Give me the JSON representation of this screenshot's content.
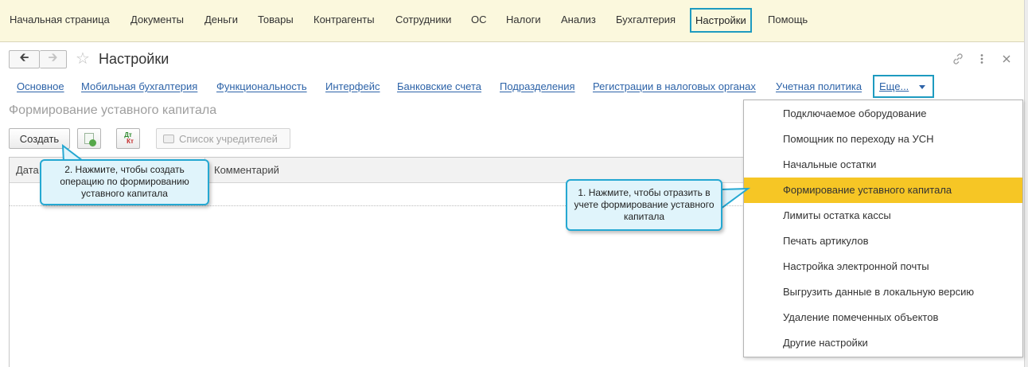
{
  "top_nav": {
    "items": [
      {
        "label": "Начальная страница"
      },
      {
        "label": "Документы"
      },
      {
        "label": "Деньги"
      },
      {
        "label": "Товары"
      },
      {
        "label": "Контрагенты"
      },
      {
        "label": "Сотрудники"
      },
      {
        "label": "ОС"
      },
      {
        "label": "Налоги"
      },
      {
        "label": "Анализ"
      },
      {
        "label": "Бухгалтерия"
      },
      {
        "label": "Настройки",
        "active": true
      },
      {
        "label": "Помощь"
      }
    ]
  },
  "window": {
    "back_icon": "arrow-left-icon",
    "forward_icon": "arrow-right-icon",
    "favorite_icon": "star-icon",
    "title": "Настройки",
    "link_icon": "link-icon",
    "menu_icon": "more-vertical-icon",
    "close_icon": "close-icon"
  },
  "tabs": {
    "items": [
      {
        "label": "Основное"
      },
      {
        "label": "Мобильная бухгалтерия"
      },
      {
        "label": "Функциональность"
      },
      {
        "label": "Интерфейс"
      },
      {
        "label": "Банковские счета"
      },
      {
        "label": "Подразделения"
      },
      {
        "label": "Регистрации в налоговых органах"
      },
      {
        "label": "Учетная политика"
      }
    ],
    "more_label": "Еще..."
  },
  "section_title": "Формирование уставного капитала",
  "toolbar": {
    "create_label": "Создать",
    "add_doc_icon": "document-add-icon",
    "dtkt_icon": "dt-kt-icon",
    "dtkt_dt": "Дт",
    "dtkt_kt": "Кт",
    "printer_icon": "printer-icon",
    "founders_label": "Список учредителей"
  },
  "table": {
    "columns": [
      "Дата",
      "Комментарий"
    ]
  },
  "dropdown": {
    "items": [
      {
        "label": "Подключаемое оборудование"
      },
      {
        "label": "Помощник по переходу на УСН"
      },
      {
        "label": "Начальные остатки"
      },
      {
        "label": "Формирование уставного капитала",
        "highlighted": true
      },
      {
        "label": "Лимиты остатка кассы"
      },
      {
        "label": "Печать артикулов"
      },
      {
        "label": "Настройка электронной почты"
      },
      {
        "label": "Выгрузить данные в локальную версию"
      },
      {
        "label": "Удаление помеченных объектов"
      },
      {
        "label": "Другие настройки"
      }
    ]
  },
  "callouts": {
    "step1": "1. Нажмите, чтобы отразить в учете формирование уставного капитала",
    "step2": "2. Нажмите, чтобы создать операцию по формированию уставного капитала"
  },
  "colors": {
    "menu_background": "#fbf8dd",
    "highlight_frame": "#1e9bc0",
    "link": "#2d63a8",
    "selected_item": "#f6c625",
    "callout_background": "#e0f4fb"
  }
}
